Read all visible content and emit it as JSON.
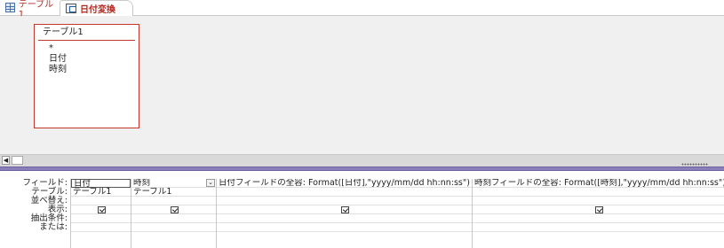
{
  "tabs": [
    {
      "label": "テーブル1",
      "icon": "table-icon"
    },
    {
      "label": "日付変換",
      "icon": "query-icon"
    }
  ],
  "table_box": {
    "title": "テーブル1",
    "fields": [
      "*",
      "日付",
      "時刻"
    ]
  },
  "grid": {
    "row_labels": [
      "フィールド:",
      "テーブル:",
      "並べ替え:",
      "表示:",
      "抽出条件:",
      "または:"
    ],
    "columns": [
      {
        "field": "日付",
        "table": "テーブル1",
        "show": true
      },
      {
        "field": "時刻",
        "table": "テーブル1",
        "show": true
      },
      {
        "field": "日付フィールドの全容: Format([日付],\"yyyy/mm/dd hh:nn:ss\")",
        "table": "",
        "show": true
      },
      {
        "field": "時刻フィールドの全容: Format([時刻],\"yyyy/mm/dd hh:nn:ss\")",
        "table": "",
        "show": true
      }
    ]
  },
  "colors": {
    "accent": "#b3261e",
    "splitter": "#8a7fb8",
    "design_bg": "#f0f0f0"
  }
}
